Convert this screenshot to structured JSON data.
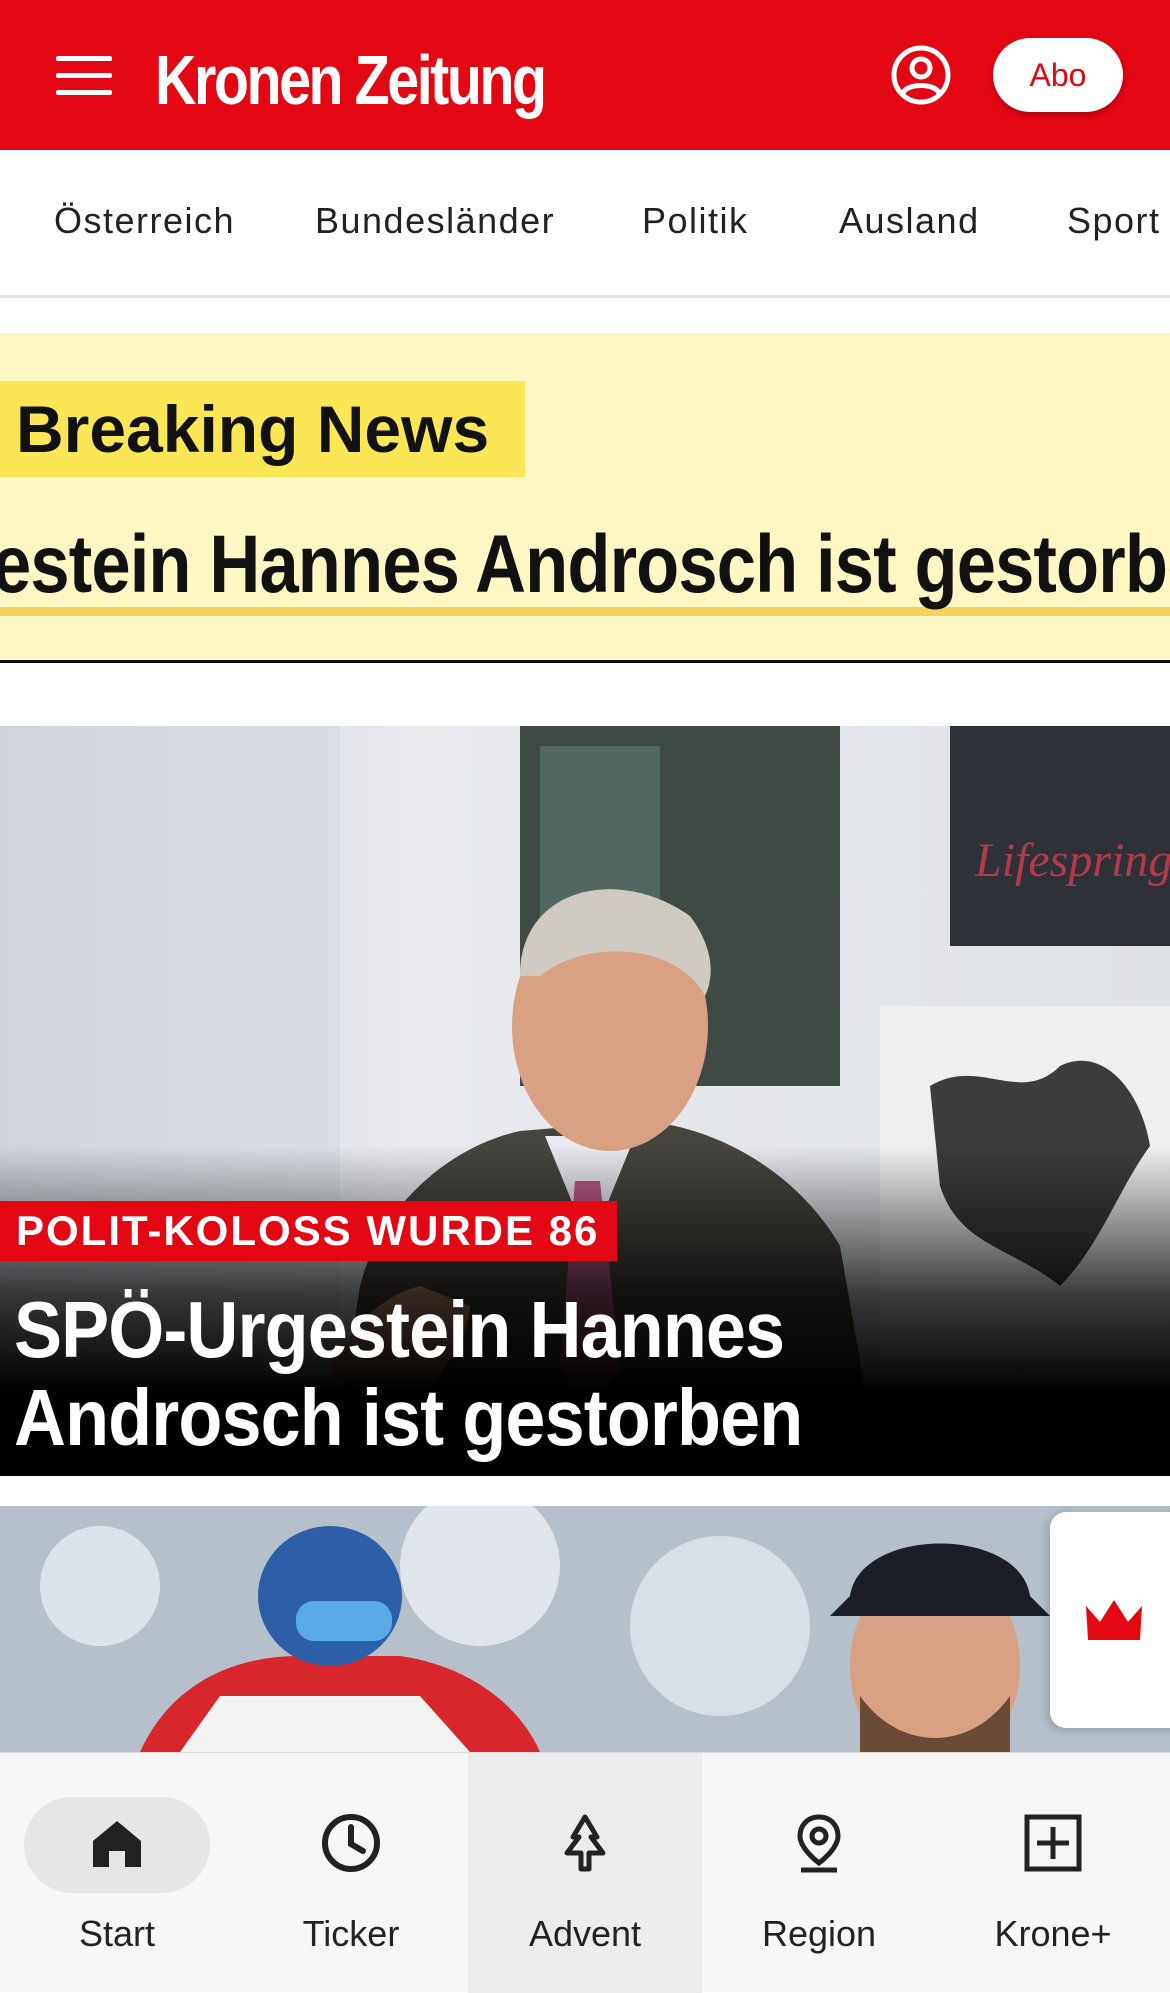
{
  "header": {
    "logo": "Kronen Zeitung",
    "abo_label": "Abo"
  },
  "nav": {
    "items": [
      "Österreich",
      "Bundesländer",
      "Politik",
      "Ausland",
      "Sport"
    ]
  },
  "breaking": {
    "label": "Breaking News",
    "ticker": "estein Hannes Androsch ist gestorben"
  },
  "hero": {
    "kicker": "POLIT-KOLOSS WURDE 86",
    "title": "SPÖ-Urgestein Hannes Androsch ist gestorben"
  },
  "bottom_nav": {
    "tabs": [
      {
        "label": "Start",
        "icon": "home-icon"
      },
      {
        "label": "Ticker",
        "icon": "clock-icon"
      },
      {
        "label": "Advent",
        "icon": "tree-icon"
      },
      {
        "label": "Region",
        "icon": "location-pin-icon"
      },
      {
        "label": "Krone+",
        "icon": "plus-box-icon"
      }
    ]
  },
  "colors": {
    "brand_red": "#e30613",
    "breaking_bg": "#fdf7c3",
    "breaking_label_bg": "#fbe655"
  }
}
